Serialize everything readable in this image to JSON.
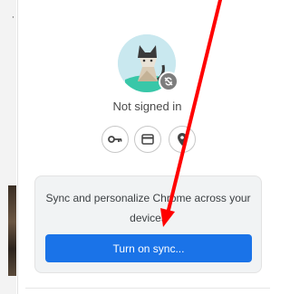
{
  "profile": {
    "status_text": "Not signed in",
    "avatar_icon": "origami-cat-avatar",
    "badge_icon": "sync-off-icon"
  },
  "quick_actions": [
    {
      "icon": "key-icon"
    },
    {
      "icon": "credit-card-icon"
    },
    {
      "icon": "location-pin-icon"
    }
  ],
  "sync": {
    "description": "Sync and personalize Chrome across your devices",
    "button_label": "Turn on sync..."
  },
  "colors": {
    "accent": "#1a73e8",
    "annotation_arrow": "#ff0000",
    "card_bg": "#f1f3f4"
  }
}
